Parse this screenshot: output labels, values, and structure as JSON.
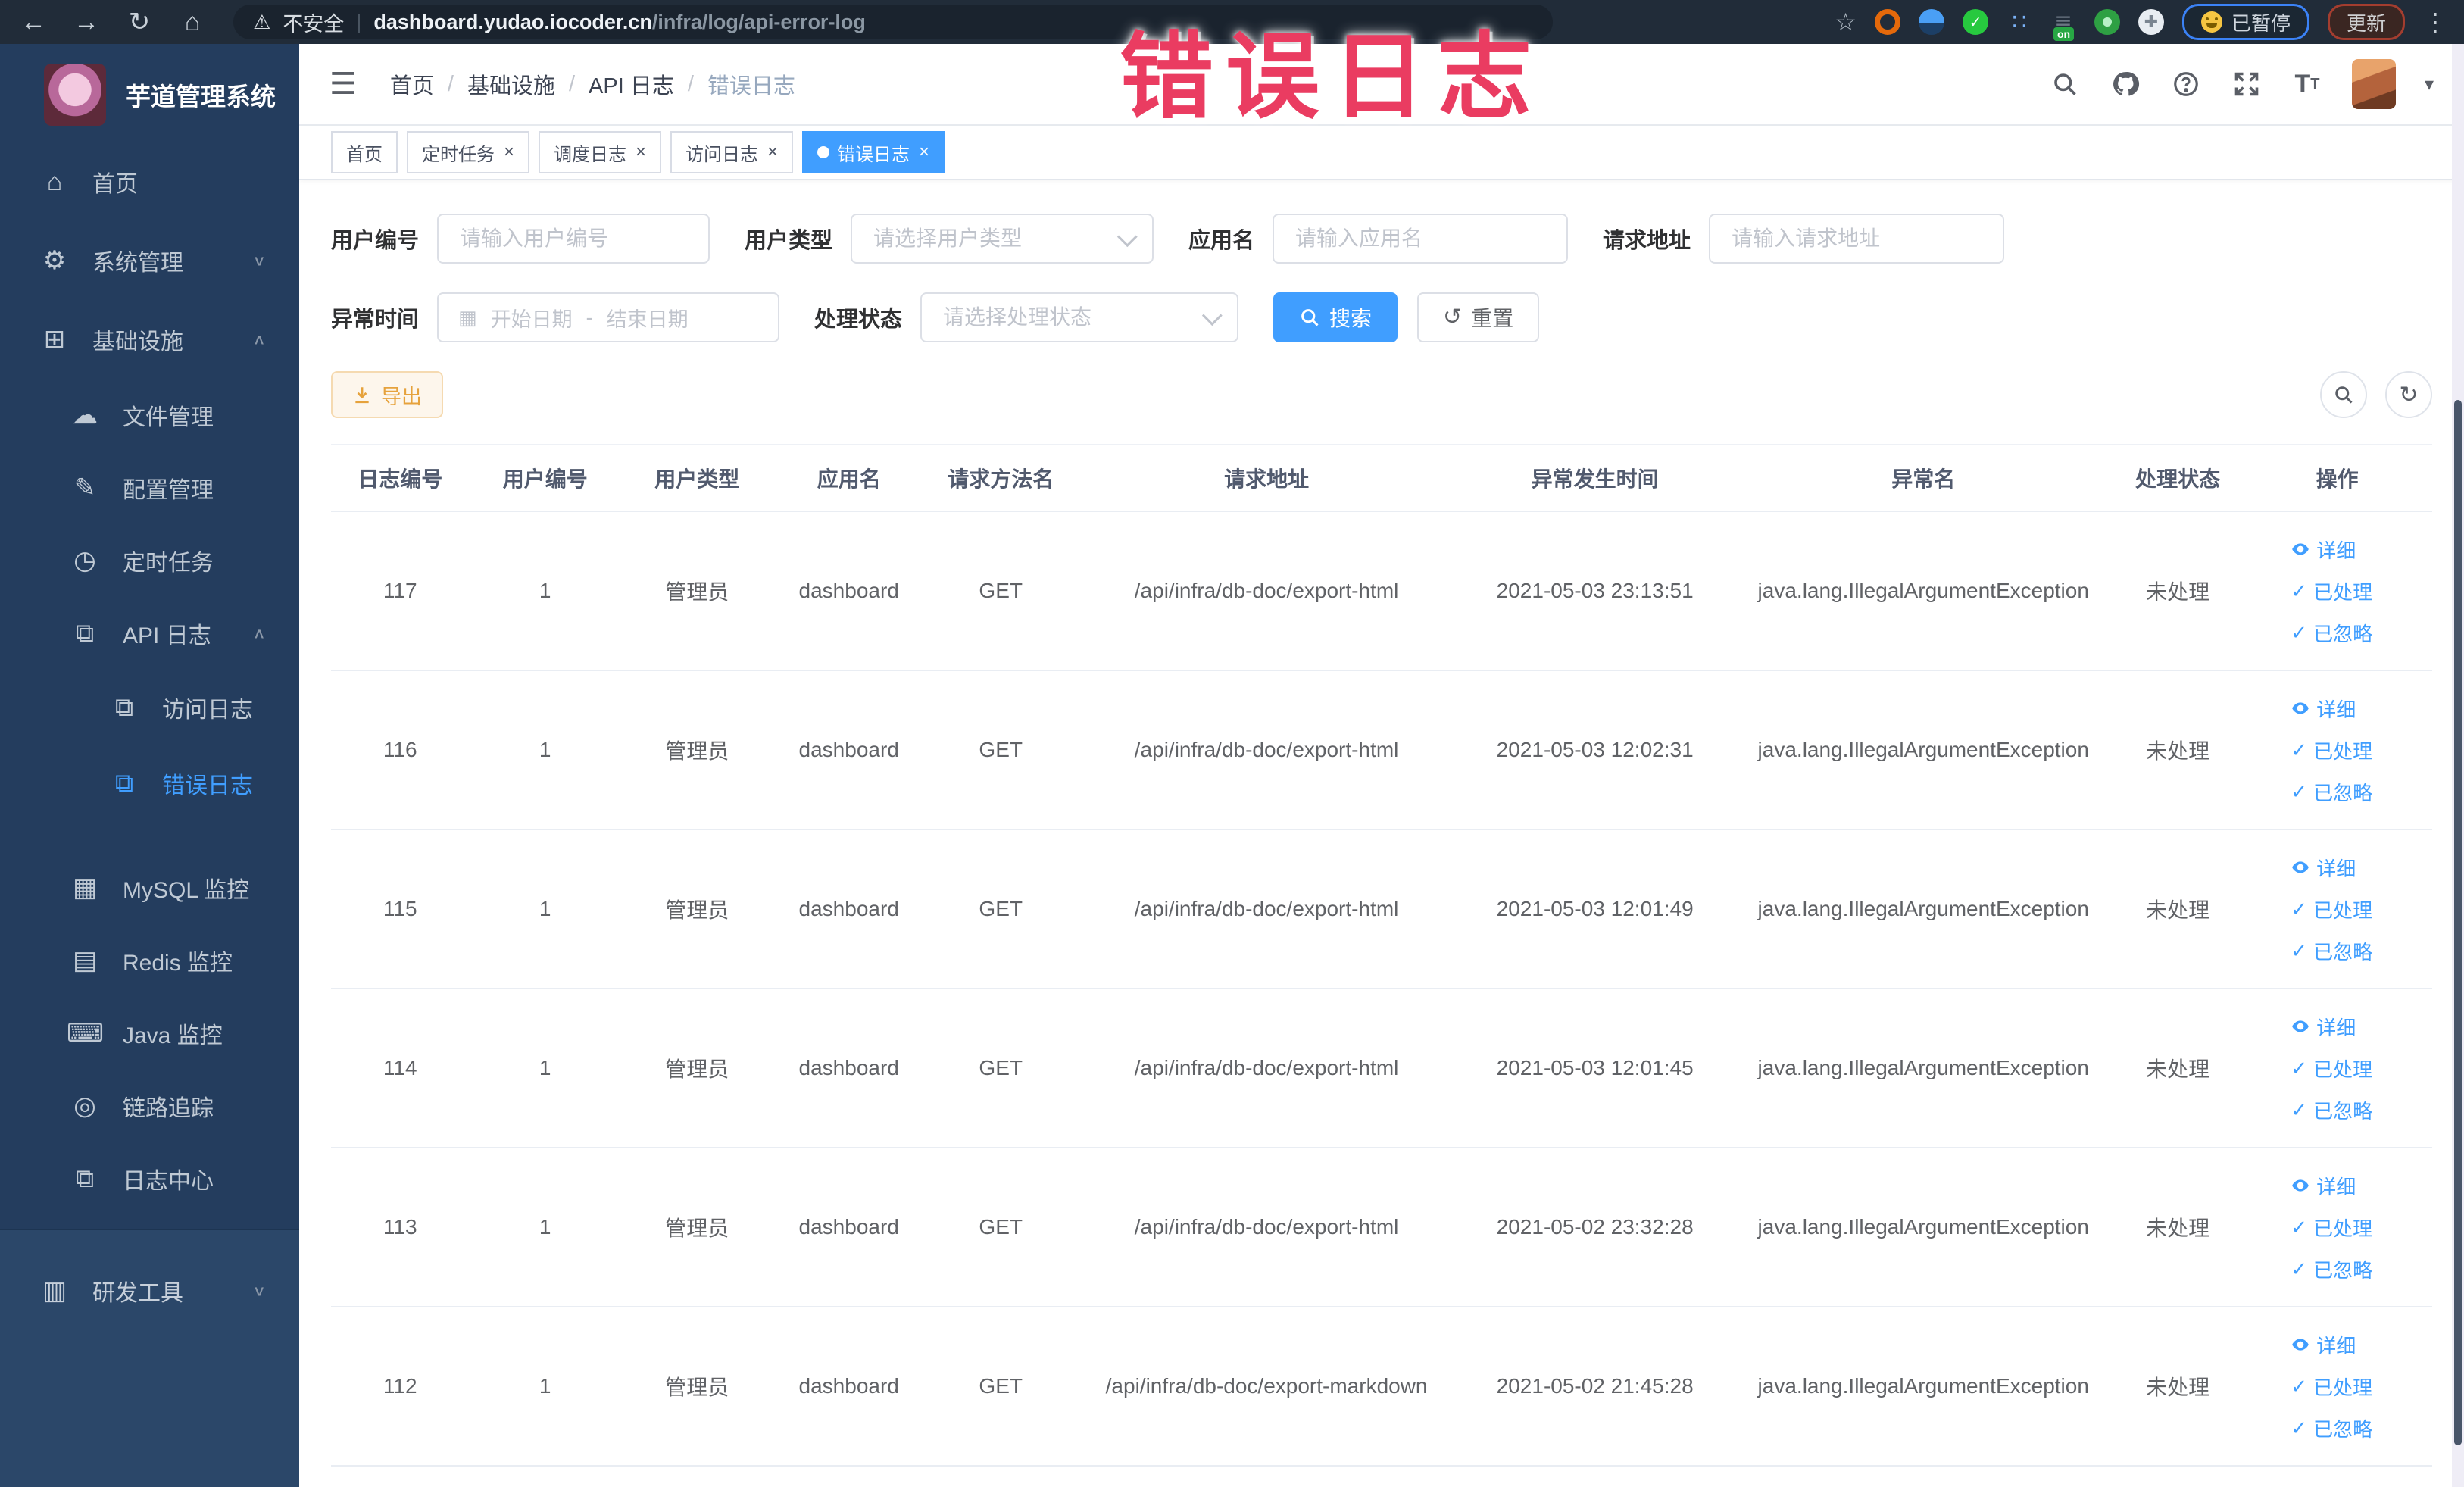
{
  "browser": {
    "security_label": "不安全",
    "url_host": "dashboard.yudao.iocoder.cn",
    "url_path": "/infra/log/api-error-log",
    "paused_label": "已暂停",
    "update_label": "更新"
  },
  "watermark": {
    "text": "错误日志"
  },
  "sidebar": {
    "title": "芋道管理系统",
    "items": [
      {
        "key": "home",
        "label": "首页",
        "level": 1
      },
      {
        "key": "system",
        "label": "系统管理",
        "level": 1,
        "arrow": "down"
      },
      {
        "key": "infra",
        "label": "基础设施",
        "level": 1,
        "arrow": "up"
      },
      {
        "key": "file",
        "label": "文件管理",
        "level": 2
      },
      {
        "key": "config",
        "label": "配置管理",
        "level": 2
      },
      {
        "key": "job",
        "label": "定时任务",
        "level": 2
      },
      {
        "key": "api-log",
        "label": "API 日志",
        "level": 2,
        "arrow": "up"
      },
      {
        "key": "access-log",
        "label": "访问日志",
        "level": 3
      },
      {
        "key": "error-log",
        "label": "错误日志",
        "level": 3,
        "active": true
      },
      {
        "key": "mysql",
        "label": "MySQL 监控",
        "level": 2,
        "gap_before": true
      },
      {
        "key": "redis",
        "label": "Redis 监控",
        "level": 2
      },
      {
        "key": "java",
        "label": "Java 监控",
        "level": 2
      },
      {
        "key": "tracer",
        "label": "链路追踪",
        "level": 2
      },
      {
        "key": "log-center",
        "label": "日志中心",
        "level": 2
      },
      {
        "key": "dev-tools",
        "label": "研发工具",
        "level": 1,
        "arrow": "down",
        "light": true
      }
    ]
  },
  "breadcrumb": [
    "首页",
    "基础设施",
    "API 日志",
    "错误日志"
  ],
  "tabs": [
    {
      "key": "home",
      "label": "首页",
      "closable": false,
      "active": false
    },
    {
      "key": "job",
      "label": "定时任务",
      "closable": true,
      "active": false
    },
    {
      "key": "job-log",
      "label": "调度日志",
      "closable": true,
      "active": false
    },
    {
      "key": "access-log",
      "label": "访问日志",
      "closable": true,
      "active": false
    },
    {
      "key": "error-log",
      "label": "错误日志",
      "closable": true,
      "active": true
    }
  ],
  "filters": {
    "user_id_label": "用户编号",
    "user_id_placeholder": "请输入用户编号",
    "user_type_label": "用户类型",
    "user_type_placeholder": "请选择用户类型",
    "app_name_label": "应用名",
    "app_name_placeholder": "请输入应用名",
    "request_url_label": "请求地址",
    "request_url_placeholder": "请输入请求地址",
    "time_label": "异常时间",
    "time_start_placeholder": "开始日期",
    "time_separator": "-",
    "time_end_placeholder": "结束日期",
    "status_label": "处理状态",
    "status_placeholder": "请选择处理状态",
    "search_label": "搜索",
    "reset_label": "重置"
  },
  "toolbar": {
    "export_label": "导出"
  },
  "table": {
    "columns": [
      "日志编号",
      "用户编号",
      "用户类型",
      "应用名",
      "请求方法名",
      "请求地址",
      "异常发生时间",
      "异常名",
      "处理状态",
      "操作"
    ],
    "row_actions": {
      "detail": "详细",
      "process": "已处理",
      "ignore": "已忽略"
    },
    "rows": [
      {
        "id": "117",
        "user_id": "1",
        "user_type": "管理员",
        "app": "dashboard",
        "method": "GET",
        "url": "/api/infra/db-doc/export-html",
        "time": "2021-05-03 23:13:51",
        "exception": "java.lang.IllegalArgumentException",
        "status": "未处理"
      },
      {
        "id": "116",
        "user_id": "1",
        "user_type": "管理员",
        "app": "dashboard",
        "method": "GET",
        "url": "/api/infra/db-doc/export-html",
        "time": "2021-05-03 12:02:31",
        "exception": "java.lang.IllegalArgumentException",
        "status": "未处理"
      },
      {
        "id": "115",
        "user_id": "1",
        "user_type": "管理员",
        "app": "dashboard",
        "method": "GET",
        "url": "/api/infra/db-doc/export-html",
        "time": "2021-05-03 12:01:49",
        "exception": "java.lang.IllegalArgumentException",
        "status": "未处理"
      },
      {
        "id": "114",
        "user_id": "1",
        "user_type": "管理员",
        "app": "dashboard",
        "method": "GET",
        "url": "/api/infra/db-doc/export-html",
        "time": "2021-05-03 12:01:45",
        "exception": "java.lang.IllegalArgumentException",
        "status": "未处理"
      },
      {
        "id": "113",
        "user_id": "1",
        "user_type": "管理员",
        "app": "dashboard",
        "method": "GET",
        "url": "/api/infra/db-doc/export-html",
        "time": "2021-05-02 23:32:28",
        "exception": "java.lang.IllegalArgumentException",
        "status": "未处理"
      },
      {
        "id": "112",
        "user_id": "1",
        "user_type": "管理员",
        "app": "dashboard",
        "method": "GET",
        "url": "/api/infra/db-doc/export-markdown",
        "time": "2021-05-02 21:45:28",
        "exception": "java.lang.IllegalArgumentException",
        "status": "未处理"
      }
    ]
  },
  "colors": {
    "accent": "#409eff",
    "sidebar_bg": "#243d5e",
    "watermark": "#ea3c61",
    "export_text": "#e6a23c",
    "chrome_bg": "#212c39"
  }
}
